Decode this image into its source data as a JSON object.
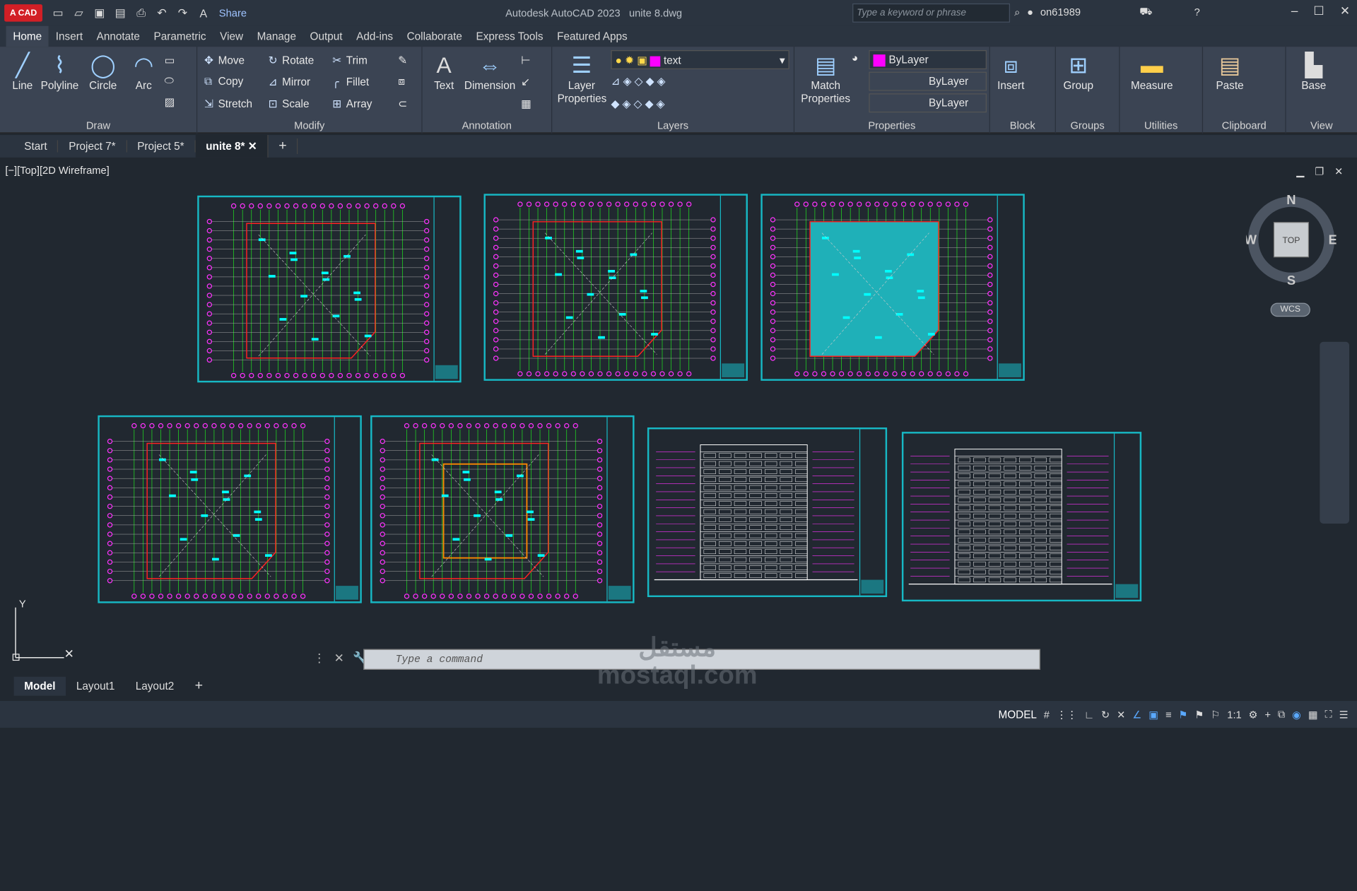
{
  "app": {
    "logo": "A CAD",
    "title": "Autodesk AutoCAD 2023",
    "file": "unite 8.dwg",
    "search_placeholder": "Type a keyword or phrase",
    "user": "on61989",
    "share": "Share"
  },
  "ribbon_tabs": [
    "Home",
    "Insert",
    "Annotate",
    "Parametric",
    "View",
    "Manage",
    "Output",
    "Add-ins",
    "Collaborate",
    "Express Tools",
    "Featured Apps"
  ],
  "draw": {
    "title": "Draw",
    "line": "Line",
    "polyline": "Polyline",
    "circle": "Circle",
    "arc": "Arc"
  },
  "modify": {
    "title": "Modify",
    "move": "Move",
    "rotate": "Rotate",
    "trim": "Trim",
    "copy": "Copy",
    "mirror": "Mirror",
    "fillet": "Fillet",
    "stretch": "Stretch",
    "scale": "Scale",
    "array": "Array"
  },
  "annotation": {
    "title": "Annotation",
    "text": "Text",
    "dimension": "Dimension"
  },
  "layers": {
    "title": "Layers",
    "layer_properties": "Layer Properties",
    "current_layer": "text"
  },
  "properties": {
    "title": "Properties",
    "match": "Match Properties",
    "color": "ByLayer",
    "linetype": "ByLayer",
    "lineweight": "ByLayer"
  },
  "block": {
    "title": "Block",
    "insert": "Insert"
  },
  "groups": {
    "title": "Groups",
    "group": "Group"
  },
  "utilities": {
    "title": "Utilities",
    "measure": "Measure"
  },
  "clipboard": {
    "title": "Clipboard",
    "paste": "Paste"
  },
  "view": {
    "title": "View",
    "base": "Base"
  },
  "file_tabs": [
    "Start",
    "Project 7*",
    "Project 5*",
    "unite 8*"
  ],
  "viewport_label": "[−][Top][2D Wireframe]",
  "viewcube": {
    "n": "N",
    "s": "S",
    "e": "E",
    "w": "W",
    "top": "TOP",
    "wcs": "WCS"
  },
  "command_placeholder": "Type a command",
  "layout_tabs": [
    "Model",
    "Layout1",
    "Layout2"
  ],
  "status": {
    "model": "MODEL",
    "scale": "1:1"
  },
  "watermark": {
    "line1": "مستقل",
    "line2": "mostaql.com"
  },
  "colors": {
    "accent": "#17b8c4",
    "magenta": "#ff00ff",
    "ribbon": "#3b4453"
  }
}
